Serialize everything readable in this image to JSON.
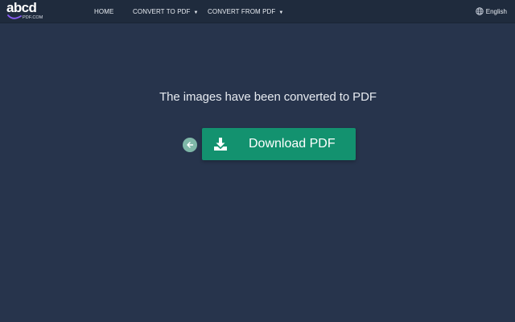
{
  "brand": {
    "logo_text": "abcd",
    "logo_subtext": "PDF.COM"
  },
  "nav": {
    "items": [
      {
        "label": "HOME",
        "has_dropdown": false
      },
      {
        "label": "CONVERT TO PDF",
        "has_dropdown": true
      },
      {
        "label": "CONVERT FROM PDF",
        "has_dropdown": true
      }
    ],
    "language": {
      "label": "English",
      "icon": "globe-icon"
    }
  },
  "main": {
    "message": "The images have been converted to PDF",
    "back_button": {
      "icon": "arrow-left-icon"
    },
    "download_button": {
      "label": "Download PDF",
      "icon": "download-icon"
    }
  },
  "colors": {
    "background": "#27344c",
    "navbar": "#1f2b3d",
    "download_button": "#13926f",
    "back_button": "#7fb7a8"
  }
}
